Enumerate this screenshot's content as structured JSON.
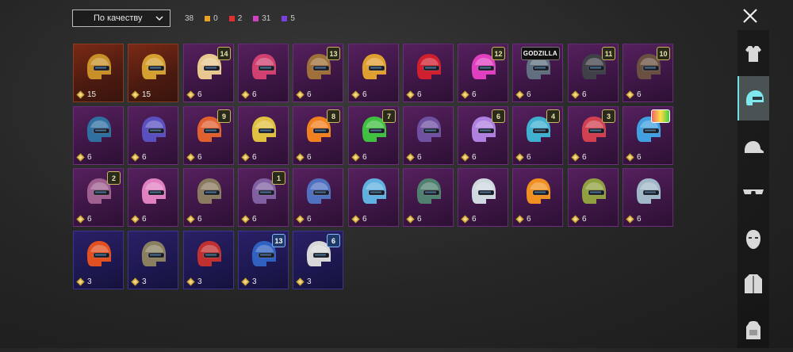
{
  "sort": {
    "label": "По качеству"
  },
  "counts": {
    "total": "38",
    "categories": [
      {
        "color": "#e8a020",
        "value": "0"
      },
      {
        "color": "#e03030",
        "value": "2"
      },
      {
        "color": "#d040c0",
        "value": "31"
      },
      {
        "color": "#7a40e0",
        "value": "5"
      }
    ]
  },
  "sidebar": [
    {
      "icon": "outfit-icon"
    },
    {
      "icon": "helmet-icon",
      "active": true
    },
    {
      "icon": "cap-icon"
    },
    {
      "icon": "glasses-icon"
    },
    {
      "icon": "mask-icon"
    },
    {
      "icon": "jacket-icon"
    },
    {
      "icon": "backpack-icon"
    }
  ],
  "items": [
    {
      "rarity": "orange",
      "cost": "15",
      "badge": "",
      "hue": "#c9902a"
    },
    {
      "rarity": "orange",
      "cost": "15",
      "badge": "",
      "hue": "#d4a030"
    },
    {
      "rarity": "purple",
      "cost": "6",
      "badge": "14",
      "hue": "#e8c890"
    },
    {
      "rarity": "purple",
      "cost": "6",
      "badge": "",
      "hue": "#d04070"
    },
    {
      "rarity": "purple",
      "cost": "6",
      "badge": "13",
      "hue": "#a0703a"
    },
    {
      "rarity": "purple",
      "cost": "6",
      "badge": "",
      "hue": "#e0a030"
    },
    {
      "rarity": "purple",
      "cost": "6",
      "badge": "",
      "hue": "#d02030"
    },
    {
      "rarity": "purple",
      "cost": "6",
      "badge": "12",
      "hue": "#e040c0"
    },
    {
      "rarity": "purple",
      "cost": "6",
      "badge": "GODZILLA",
      "badgeType": "text",
      "hue": "#607080"
    },
    {
      "rarity": "purple",
      "cost": "6",
      "badge": "11",
      "hue": "#404048"
    },
    {
      "rarity": "purple",
      "cost": "6",
      "badge": "10",
      "hue": "#6a5040"
    },
    {
      "rarity": "purple",
      "cost": "6",
      "badge": "",
      "hue": "#3070a0"
    },
    {
      "rarity": "purple",
      "cost": "6",
      "badge": "",
      "hue": "#5a50c0"
    },
    {
      "rarity": "purple",
      "cost": "6",
      "badge": "9",
      "hue": "#e06030"
    },
    {
      "rarity": "purple",
      "cost": "6",
      "badge": "",
      "hue": "#e0c040"
    },
    {
      "rarity": "purple",
      "cost": "6",
      "badge": "8",
      "hue": "#f08020"
    },
    {
      "rarity": "purple",
      "cost": "6",
      "badge": "7",
      "hue": "#40c040"
    },
    {
      "rarity": "purple",
      "cost": "6",
      "badge": "",
      "hue": "#7050a0"
    },
    {
      "rarity": "purple",
      "cost": "6",
      "badge": "6",
      "hue": "#b080e0"
    },
    {
      "rarity": "purple",
      "cost": "6",
      "badge": "4",
      "hue": "#40b0d0"
    },
    {
      "rarity": "purple",
      "cost": "6",
      "badge": "3",
      "hue": "#d04050"
    },
    {
      "rarity": "purple",
      "cost": "6",
      "badge": "",
      "badgeType": "color",
      "hue": "#40a0e0"
    },
    {
      "rarity": "purple",
      "cost": "6",
      "badge": "2",
      "hue": "#a06090"
    },
    {
      "rarity": "purple",
      "cost": "6",
      "badge": "",
      "hue": "#e080c0"
    },
    {
      "rarity": "purple",
      "cost": "6",
      "badge": "",
      "hue": "#8a7a60"
    },
    {
      "rarity": "purple",
      "cost": "6",
      "badge": "1",
      "hue": "#8060a0"
    },
    {
      "rarity": "purple",
      "cost": "6",
      "badge": "",
      "hue": "#5070c0"
    },
    {
      "rarity": "purple",
      "cost": "6",
      "badge": "",
      "hue": "#60b0e0"
    },
    {
      "rarity": "purple",
      "cost": "6",
      "badge": "",
      "hue": "#508070"
    },
    {
      "rarity": "purple",
      "cost": "6",
      "badge": "",
      "hue": "#d0d8e0"
    },
    {
      "rarity": "purple",
      "cost": "6",
      "badge": "",
      "hue": "#f09020"
    },
    {
      "rarity": "purple",
      "cost": "6",
      "badge": "",
      "hue": "#90a040"
    },
    {
      "rarity": "purple",
      "cost": "6",
      "badge": "",
      "hue": "#a0b8c8"
    },
    {
      "rarity": "blue",
      "cost": "3",
      "badge": "",
      "hue": "#e05020"
    },
    {
      "rarity": "blue",
      "cost": "3",
      "badge": "",
      "hue": "#8a8060"
    },
    {
      "rarity": "blue",
      "cost": "3",
      "badge": "",
      "hue": "#c03030"
    },
    {
      "rarity": "blue",
      "cost": "3",
      "badge": "13",
      "badgeType": "blue",
      "hue": "#3060c0"
    },
    {
      "rarity": "blue",
      "cost": "3",
      "badge": "6",
      "badgeType": "blue",
      "hue": "#d8d8d8"
    }
  ]
}
